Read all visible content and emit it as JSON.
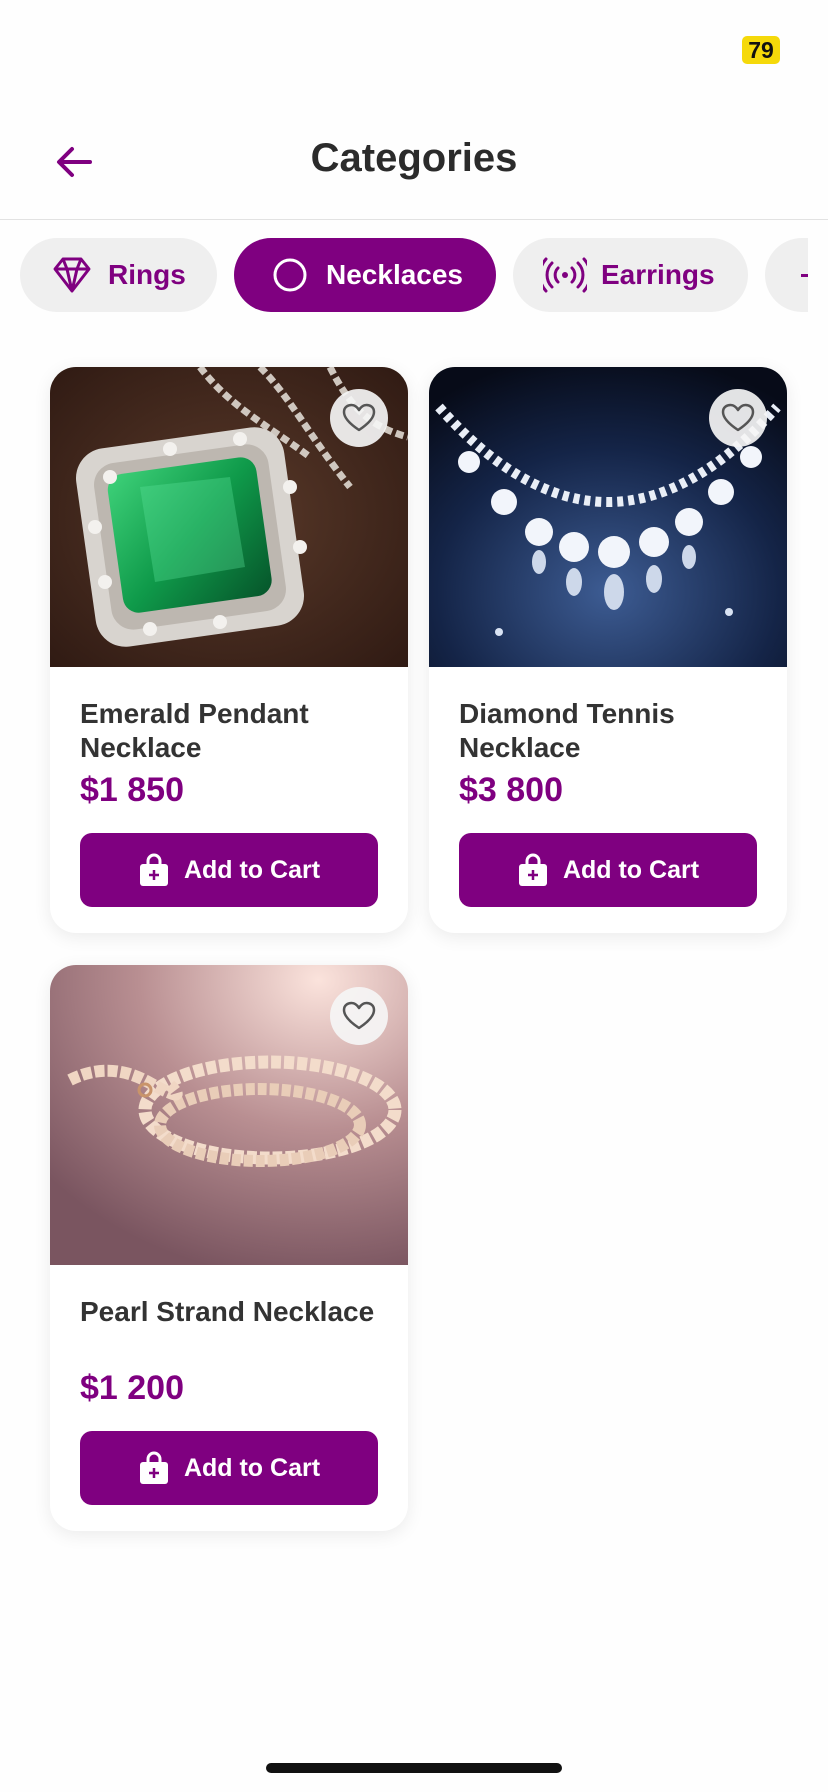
{
  "status": {
    "battery": "79"
  },
  "header": {
    "title": "Categories"
  },
  "chips": [
    {
      "label": "Rings",
      "icon": "diamond-icon",
      "active": false
    },
    {
      "label": "Necklaces",
      "icon": "circle-icon",
      "active": true
    },
    {
      "label": "Earrings",
      "icon": "broadcast-icon",
      "active": false
    }
  ],
  "products": [
    {
      "name": "Emerald Pendant Necklace",
      "price": "$1 850",
      "cart_label": "Add to Cart",
      "image": "emerald-pendant-photo"
    },
    {
      "name": "Diamond Tennis Necklace",
      "price": "$3 800",
      "cart_label": "Add to Cart",
      "image": "diamond-necklace-photo"
    },
    {
      "name": "Pearl Strand Necklace",
      "price": "$1 200",
      "cart_label": "Add to Cart",
      "image": "pearl-necklace-photo"
    }
  ],
  "colors": {
    "accent": "#7f0080",
    "chip_bg": "#efefef",
    "text": "#333333"
  }
}
